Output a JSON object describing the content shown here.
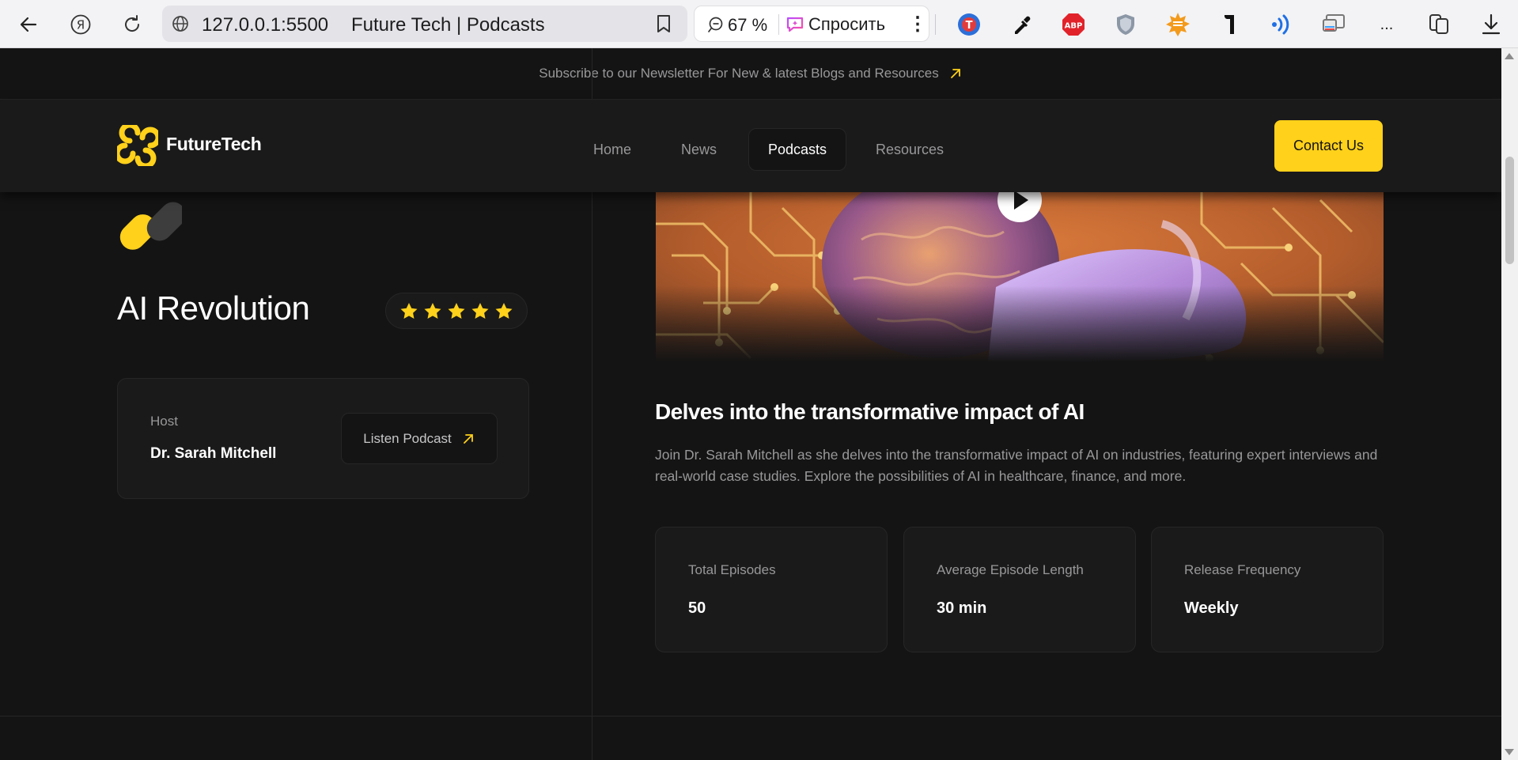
{
  "browser": {
    "url_host": "127.0.0.1:5500",
    "tab_title": "Future Tech | Podcasts",
    "zoom": "67 %",
    "ask_label": "Спросить",
    "more_label": "...",
    "extensions": [
      "translate-icon",
      "eyedropper-icon",
      "adblock-icon",
      "shield-icon",
      "sun-icon",
      "paragraph-icon",
      "signal-icon",
      "cast-icon"
    ],
    "extension_texts": {
      "adblock": "ABP"
    }
  },
  "newsletter": {
    "text": "Subscribe to our Newsletter For New & latest Blogs and Resources"
  },
  "nav": {
    "brand": "FutureTech",
    "links": [
      {
        "label": "Home",
        "active": false
      },
      {
        "label": "News",
        "active": false
      },
      {
        "label": "Podcasts",
        "active": true
      },
      {
        "label": "Resources",
        "active": false
      }
    ],
    "contact": "Contact Us"
  },
  "podcast": {
    "title": "AI Revolution",
    "rating": 5,
    "host_label": "Host",
    "host_name": "Dr. Sarah Mitchell",
    "listen_label": "Listen Podcast",
    "heading": "Delves into the transformative impact of AI",
    "description": "Join Dr. Sarah Mitchell as she delves into the transformative impact of AI on industries, featuring expert interviews and real-world case studies. Explore the possibilities of AI in healthcare, finance, and more.",
    "stats": [
      {
        "label": "Total Episodes",
        "value": "50"
      },
      {
        "label": "Average Episode Length",
        "value": "30 min"
      },
      {
        "label": "Release Frequency",
        "value": "Weekly"
      }
    ]
  },
  "colors": {
    "accent": "#ffd11a",
    "background": "#141414",
    "surface": "#1a1a1a",
    "border": "#262626",
    "muted_text": "#98989a"
  }
}
